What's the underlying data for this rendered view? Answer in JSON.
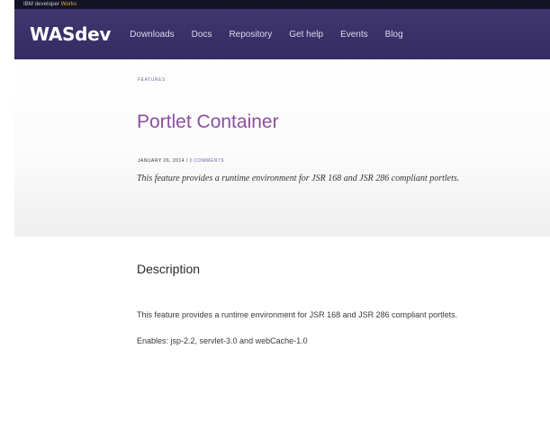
{
  "topbar": {
    "label_prefix": "IBM developer",
    "label_accent": "Works"
  },
  "navbar": {
    "brand": "WASdev",
    "items": [
      "Downloads",
      "Docs",
      "Repository",
      "Get help",
      "Events",
      "Blog"
    ]
  },
  "article": {
    "category": "FEATURES",
    "title": "Portlet Container",
    "date": "JANUARY 26, 2014",
    "separator": " / ",
    "comments": "0 COMMENTS",
    "summary": "This feature provides a runtime environment for JSR 168 and JSR 286 compliant portlets."
  },
  "description": {
    "heading": "Description",
    "line1": "This feature provides a runtime environment for JSR 168 and JSR 286 compliant portlets.",
    "line2": "Enables: jsp-2.2, servlet-3.0 and webCache-1.0"
  },
  "colors": {
    "topbar": "#141327",
    "navbar": "#3b3269",
    "title": "#8b50a0",
    "link": "#6f63a8"
  }
}
